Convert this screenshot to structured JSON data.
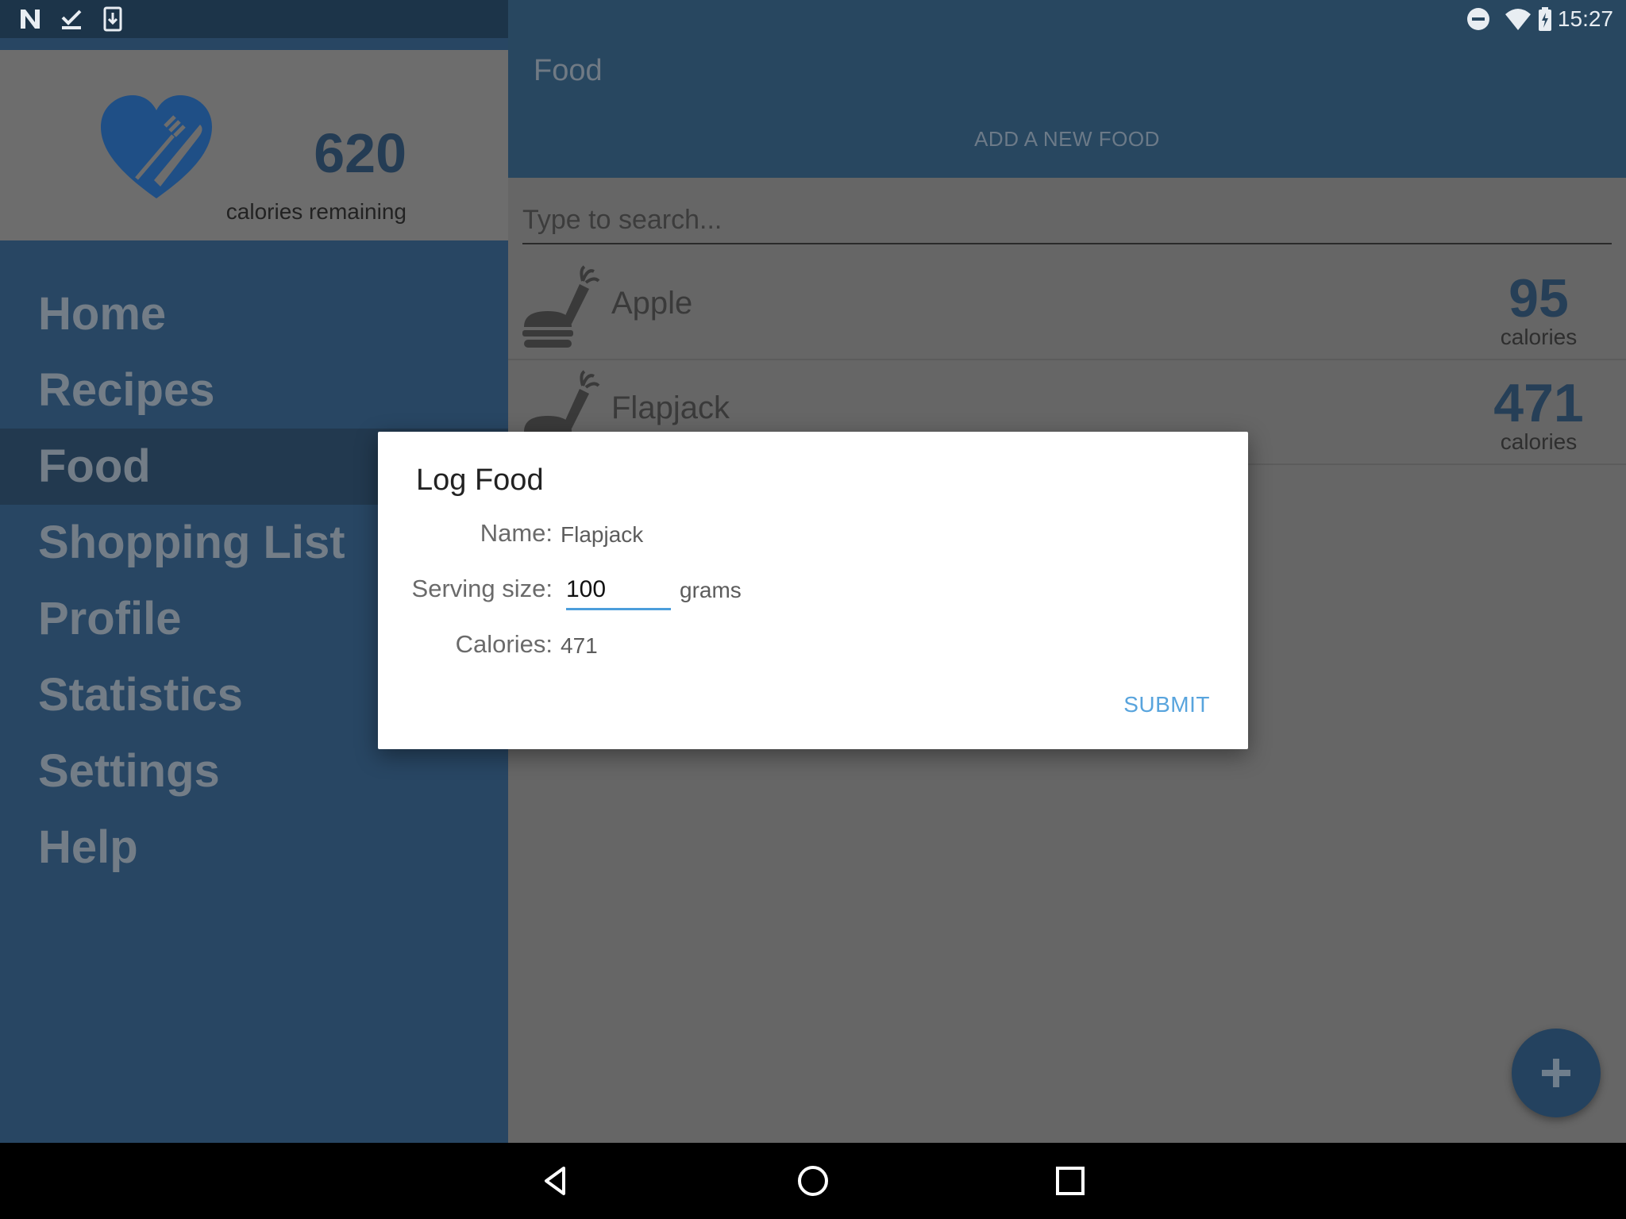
{
  "status_bar": {
    "time": "15:27",
    "left_icons": [
      "n-logo-icon",
      "check-download-icon",
      "download-icon"
    ],
    "right_icons": [
      "do-not-disturb-icon",
      "wifi-icon",
      "battery-charging-icon"
    ]
  },
  "app_bar": {
    "title": "Food",
    "tab_label": "ADD A NEW FOOD"
  },
  "search": {
    "placeholder": "Type to search..."
  },
  "food_list": [
    {
      "name": "Apple",
      "calories": "95",
      "unit": "calories",
      "icon": "food-icon"
    },
    {
      "name": "Flapjack",
      "calories": "471",
      "unit": "calories",
      "icon": "food-icon"
    }
  ],
  "drawer": {
    "calories_remaining": "620",
    "calories_label": "calories remaining",
    "logo_icon": "heart-cutlery-icon",
    "items": [
      {
        "label": "Home"
      },
      {
        "label": "Recipes"
      },
      {
        "label": "Food",
        "active": true
      },
      {
        "label": "Shopping List"
      },
      {
        "label": "Profile"
      },
      {
        "label": "Statistics"
      },
      {
        "label": "Settings"
      },
      {
        "label": "Help"
      }
    ]
  },
  "dialog": {
    "title": "Log Food",
    "name_label": "Name:",
    "name_value": "Flapjack",
    "serving_label": "Serving size:",
    "serving_value": "100",
    "serving_unit": "grams",
    "calories_label": "Calories:",
    "calories_value": "471",
    "submit_label": "SUBMIT"
  },
  "fab": {
    "icon": "plus-icon"
  },
  "nav_bar": {
    "icons": [
      "back-icon",
      "home-icon",
      "recents-icon"
    ]
  },
  "colors": {
    "primary": "#284760",
    "drawer": "#284663",
    "accent": "#58a4dd",
    "scrim": "#666666"
  }
}
